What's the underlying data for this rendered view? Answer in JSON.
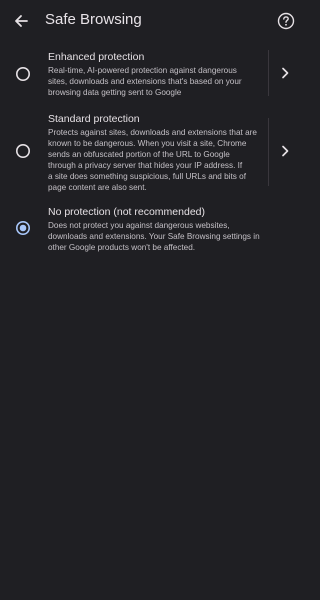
{
  "header": {
    "title": "Safe Browsing",
    "back_icon": "arrow-back-icon",
    "help_icon": "help-circle-icon"
  },
  "options": [
    {
      "title": "Enhanced protection",
      "desc_lines": [
        "Real-time, AI-powered protection against dangerous",
        "sites, downloads and extensions that's based on your",
        "browsing data getting sent to Google"
      ],
      "selected": false,
      "has_details": true
    },
    {
      "title": "Standard protection",
      "desc_lines": [
        "Protects against sites, downloads and extensions that are",
        "known to be dangerous. When you visit a site, Chrome",
        "sends an obfuscated portion of the URL to Google",
        "through a privacy server that hides your IP address. If",
        "a site does something suspicious, full URLs and bits of",
        "page content are also sent."
      ],
      "selected": false,
      "has_details": true
    },
    {
      "title": "No protection (not recommended)",
      "desc_lines": [
        "Does not protect you against dangerous websites,",
        "downloads and extensions. Your Safe Browsing settings in",
        "other Google products won't be affected."
      ],
      "selected": true,
      "has_details": false
    }
  ],
  "colors": {
    "background": "#1f1f23",
    "accent": "#a8c7fa",
    "text": "#e6e1e5",
    "subtext": "#c4c0c6"
  }
}
